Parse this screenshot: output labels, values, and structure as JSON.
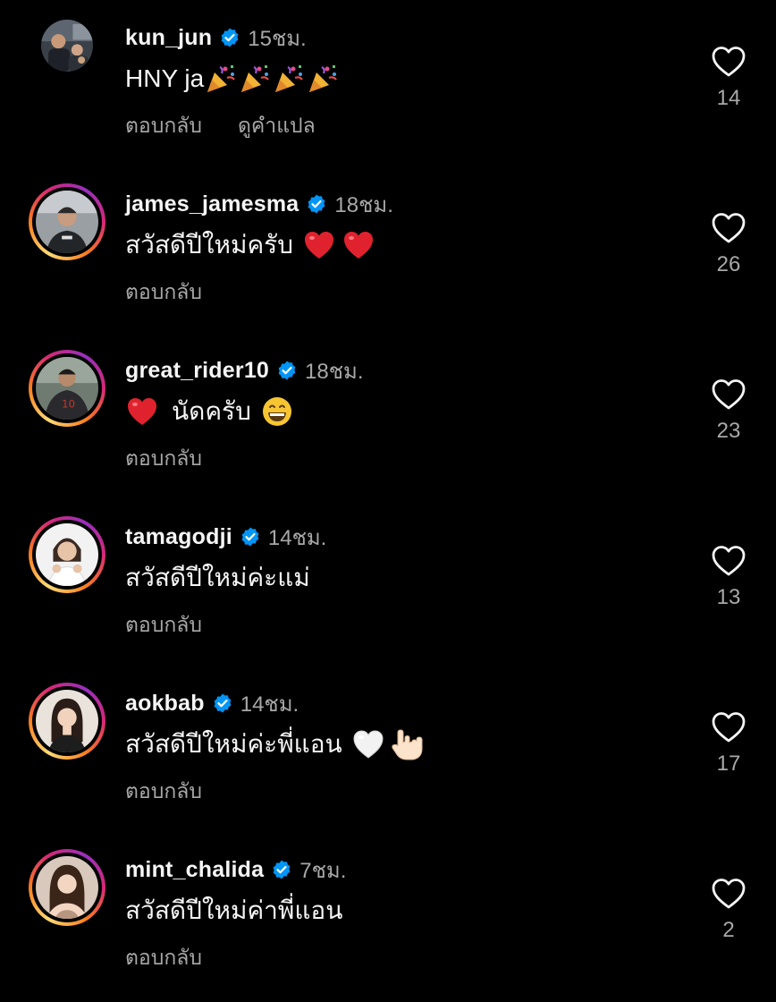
{
  "colors": {
    "background": "#000000",
    "text_primary": "#f5f5f5",
    "text_secondary": "#a8a8a8",
    "verified_badge": "#0095f6",
    "story_ring": "#d62976"
  },
  "comments": [
    {
      "username": "kun_jun",
      "verified": true,
      "time": "15ชม.",
      "text": "HNY ja",
      "emojis": [
        "party-popper",
        "party-popper",
        "party-popper",
        "party-popper"
      ],
      "reply_label": "ตอบกลับ",
      "translate_label": "ดูคำแปล",
      "likes": "14",
      "has_story_ring": false
    },
    {
      "username": "james_jamesma",
      "verified": true,
      "time": "18ชม.",
      "text": "สวัสดีปีใหม่ครับ",
      "emojis": [
        "red-heart",
        "red-heart"
      ],
      "reply_label": "ตอบกลับ",
      "likes": "26",
      "has_story_ring": true
    },
    {
      "username": "great_rider10",
      "verified": true,
      "time": "18ชม.",
      "text": "นัดครับ",
      "emojis": [
        "red-heart",
        "grinning-face"
      ],
      "reply_label": "ตอบกลับ",
      "likes": "23",
      "has_story_ring": true
    },
    {
      "username": "tamagodji",
      "verified": true,
      "time": "14ชม.",
      "text": "สวัสดีปีใหม่ค่ะแม่",
      "emojis": [],
      "reply_label": "ตอบกลับ",
      "likes": "13",
      "has_story_ring": true
    },
    {
      "username": "aokbab",
      "verified": true,
      "time": "14ชม.",
      "text": "สวัสดีปีใหม่ค่ะพี่แอน",
      "emojis": [
        "white-heart",
        "love-you-gesture"
      ],
      "reply_label": "ตอบกลับ",
      "likes": "17",
      "has_story_ring": true
    },
    {
      "username": "mint_chalida",
      "verified": true,
      "time": "7ชม.",
      "text": "สวัสดีปีใหม่ค่าพี่แอน",
      "emojis": [],
      "reply_label": "ตอบกลับ",
      "likes": "2",
      "has_story_ring": true
    }
  ]
}
